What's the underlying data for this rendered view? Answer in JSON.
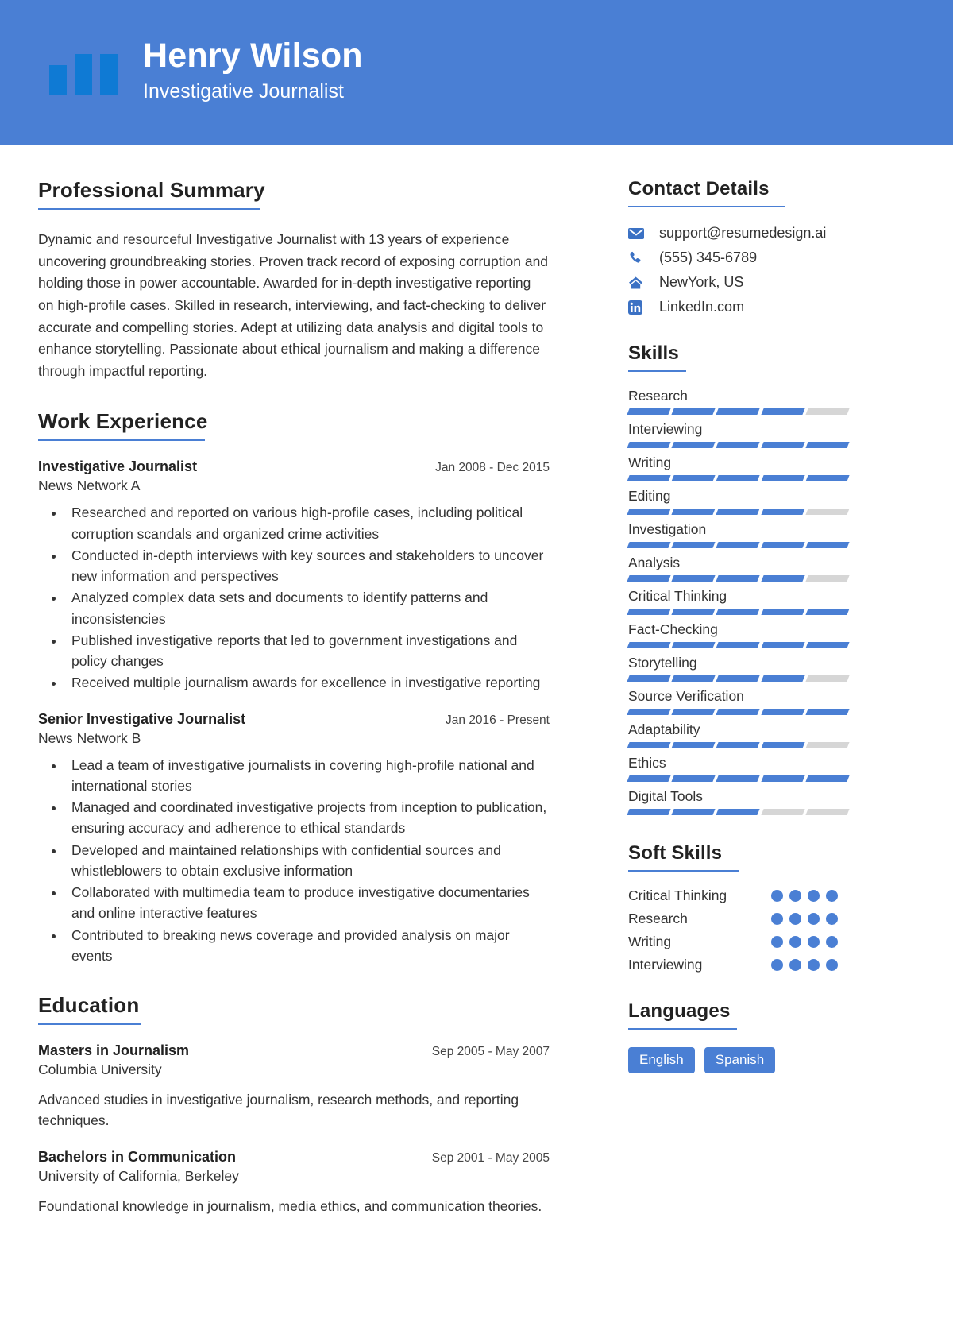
{
  "theme": {
    "header_bg": "#4a7fd4",
    "accent": "#4a7fd4",
    "logo_bar": "#0f7ad4",
    "inactive": "#d6d6d6",
    "text": "#333333"
  },
  "header": {
    "name": "Henry Wilson",
    "job_title": "Investigative Journalist",
    "logo_icon": "three-bars-logo"
  },
  "summary": {
    "heading": "Professional Summary",
    "text": "Dynamic and resourceful Investigative Journalist with 13 years of experience uncovering groundbreaking stories. Proven track record of exposing corruption and holding those in power accountable. Awarded for in-depth investigative reporting on high-profile cases. Skilled in research, interviewing, and fact-checking to deliver accurate and compelling stories. Adept at utilizing data analysis and digital tools to enhance storytelling. Passionate about ethical journalism and making a difference through impactful reporting."
  },
  "work": {
    "heading": "Work Experience",
    "jobs": [
      {
        "role": "Investigative Journalist",
        "date": "Jan 2008 - Dec 2015",
        "org": "News Network A",
        "bullets": [
          "Researched and reported on various high-profile cases, including political corruption scandals and organized crime activities",
          "Conducted in-depth interviews with key sources and stakeholders to uncover new information and perspectives",
          "Analyzed complex data sets and documents to identify patterns and inconsistencies",
          "Published investigative reports that led to government investigations and policy changes",
          "Received multiple journalism awards for excellence in investigative reporting"
        ]
      },
      {
        "role": "Senior Investigative Journalist",
        "date": "Jan 2016 - Present",
        "org": "News Network B",
        "bullets": [
          "Lead a team of investigative journalists in covering high-profile national and international stories",
          "Managed and coordinated investigative projects from inception to publication, ensuring accuracy and adherence to ethical standards",
          "Developed and maintained relationships with confidential sources and whistleblowers to obtain exclusive information",
          "Collaborated with multimedia team to produce investigative documentaries and online interactive features",
          "Contributed to breaking news coverage and provided analysis on major events"
        ]
      }
    ]
  },
  "education": {
    "heading": "Education",
    "entries": [
      {
        "degree": "Masters in Journalism",
        "date": "Sep 2005 - May 2007",
        "school": "Columbia University",
        "desc": "Advanced studies in investigative journalism, research methods, and reporting techniques."
      },
      {
        "degree": "Bachelors in Communication",
        "date": "Sep 2001 - May 2005",
        "school": "University of California, Berkeley",
        "desc": "Foundational knowledge in journalism, media ethics, and communication theories."
      }
    ]
  },
  "contact": {
    "heading": "Contact Details",
    "items": [
      {
        "icon": "envelope-icon",
        "value": "support@resumedesign.ai"
      },
      {
        "icon": "phone-icon",
        "value": "(555) 345-6789"
      },
      {
        "icon": "home-icon",
        "value": "NewYork, US"
      },
      {
        "icon": "linkedin-icon",
        "value": "LinkedIn.com"
      }
    ]
  },
  "skills": {
    "heading": "Skills",
    "segments_total": 5,
    "items": [
      {
        "label": "Research",
        "filled": 4
      },
      {
        "label": "Interviewing",
        "filled": 5
      },
      {
        "label": "Writing",
        "filled": 5
      },
      {
        "label": "Editing",
        "filled": 4
      },
      {
        "label": "Investigation",
        "filled": 5
      },
      {
        "label": "Analysis",
        "filled": 4
      },
      {
        "label": "Critical Thinking",
        "filled": 5
      },
      {
        "label": "Fact-Checking",
        "filled": 5
      },
      {
        "label": "Storytelling",
        "filled": 4
      },
      {
        "label": "Source Verification",
        "filled": 5
      },
      {
        "label": "Adaptability",
        "filled": 4
      },
      {
        "label": "Ethics",
        "filled": 5
      },
      {
        "label": "Digital Tools",
        "filled": 3
      }
    ]
  },
  "soft_skills": {
    "heading": "Soft Skills",
    "dots_total": 4,
    "items": [
      {
        "label": "Critical Thinking",
        "filled": 4
      },
      {
        "label": "Research",
        "filled": 4
      },
      {
        "label": "Writing",
        "filled": 4
      },
      {
        "label": "Interviewing",
        "filled": 4
      }
    ]
  },
  "languages": {
    "heading": "Languages",
    "items": [
      "English",
      "Spanish"
    ]
  }
}
